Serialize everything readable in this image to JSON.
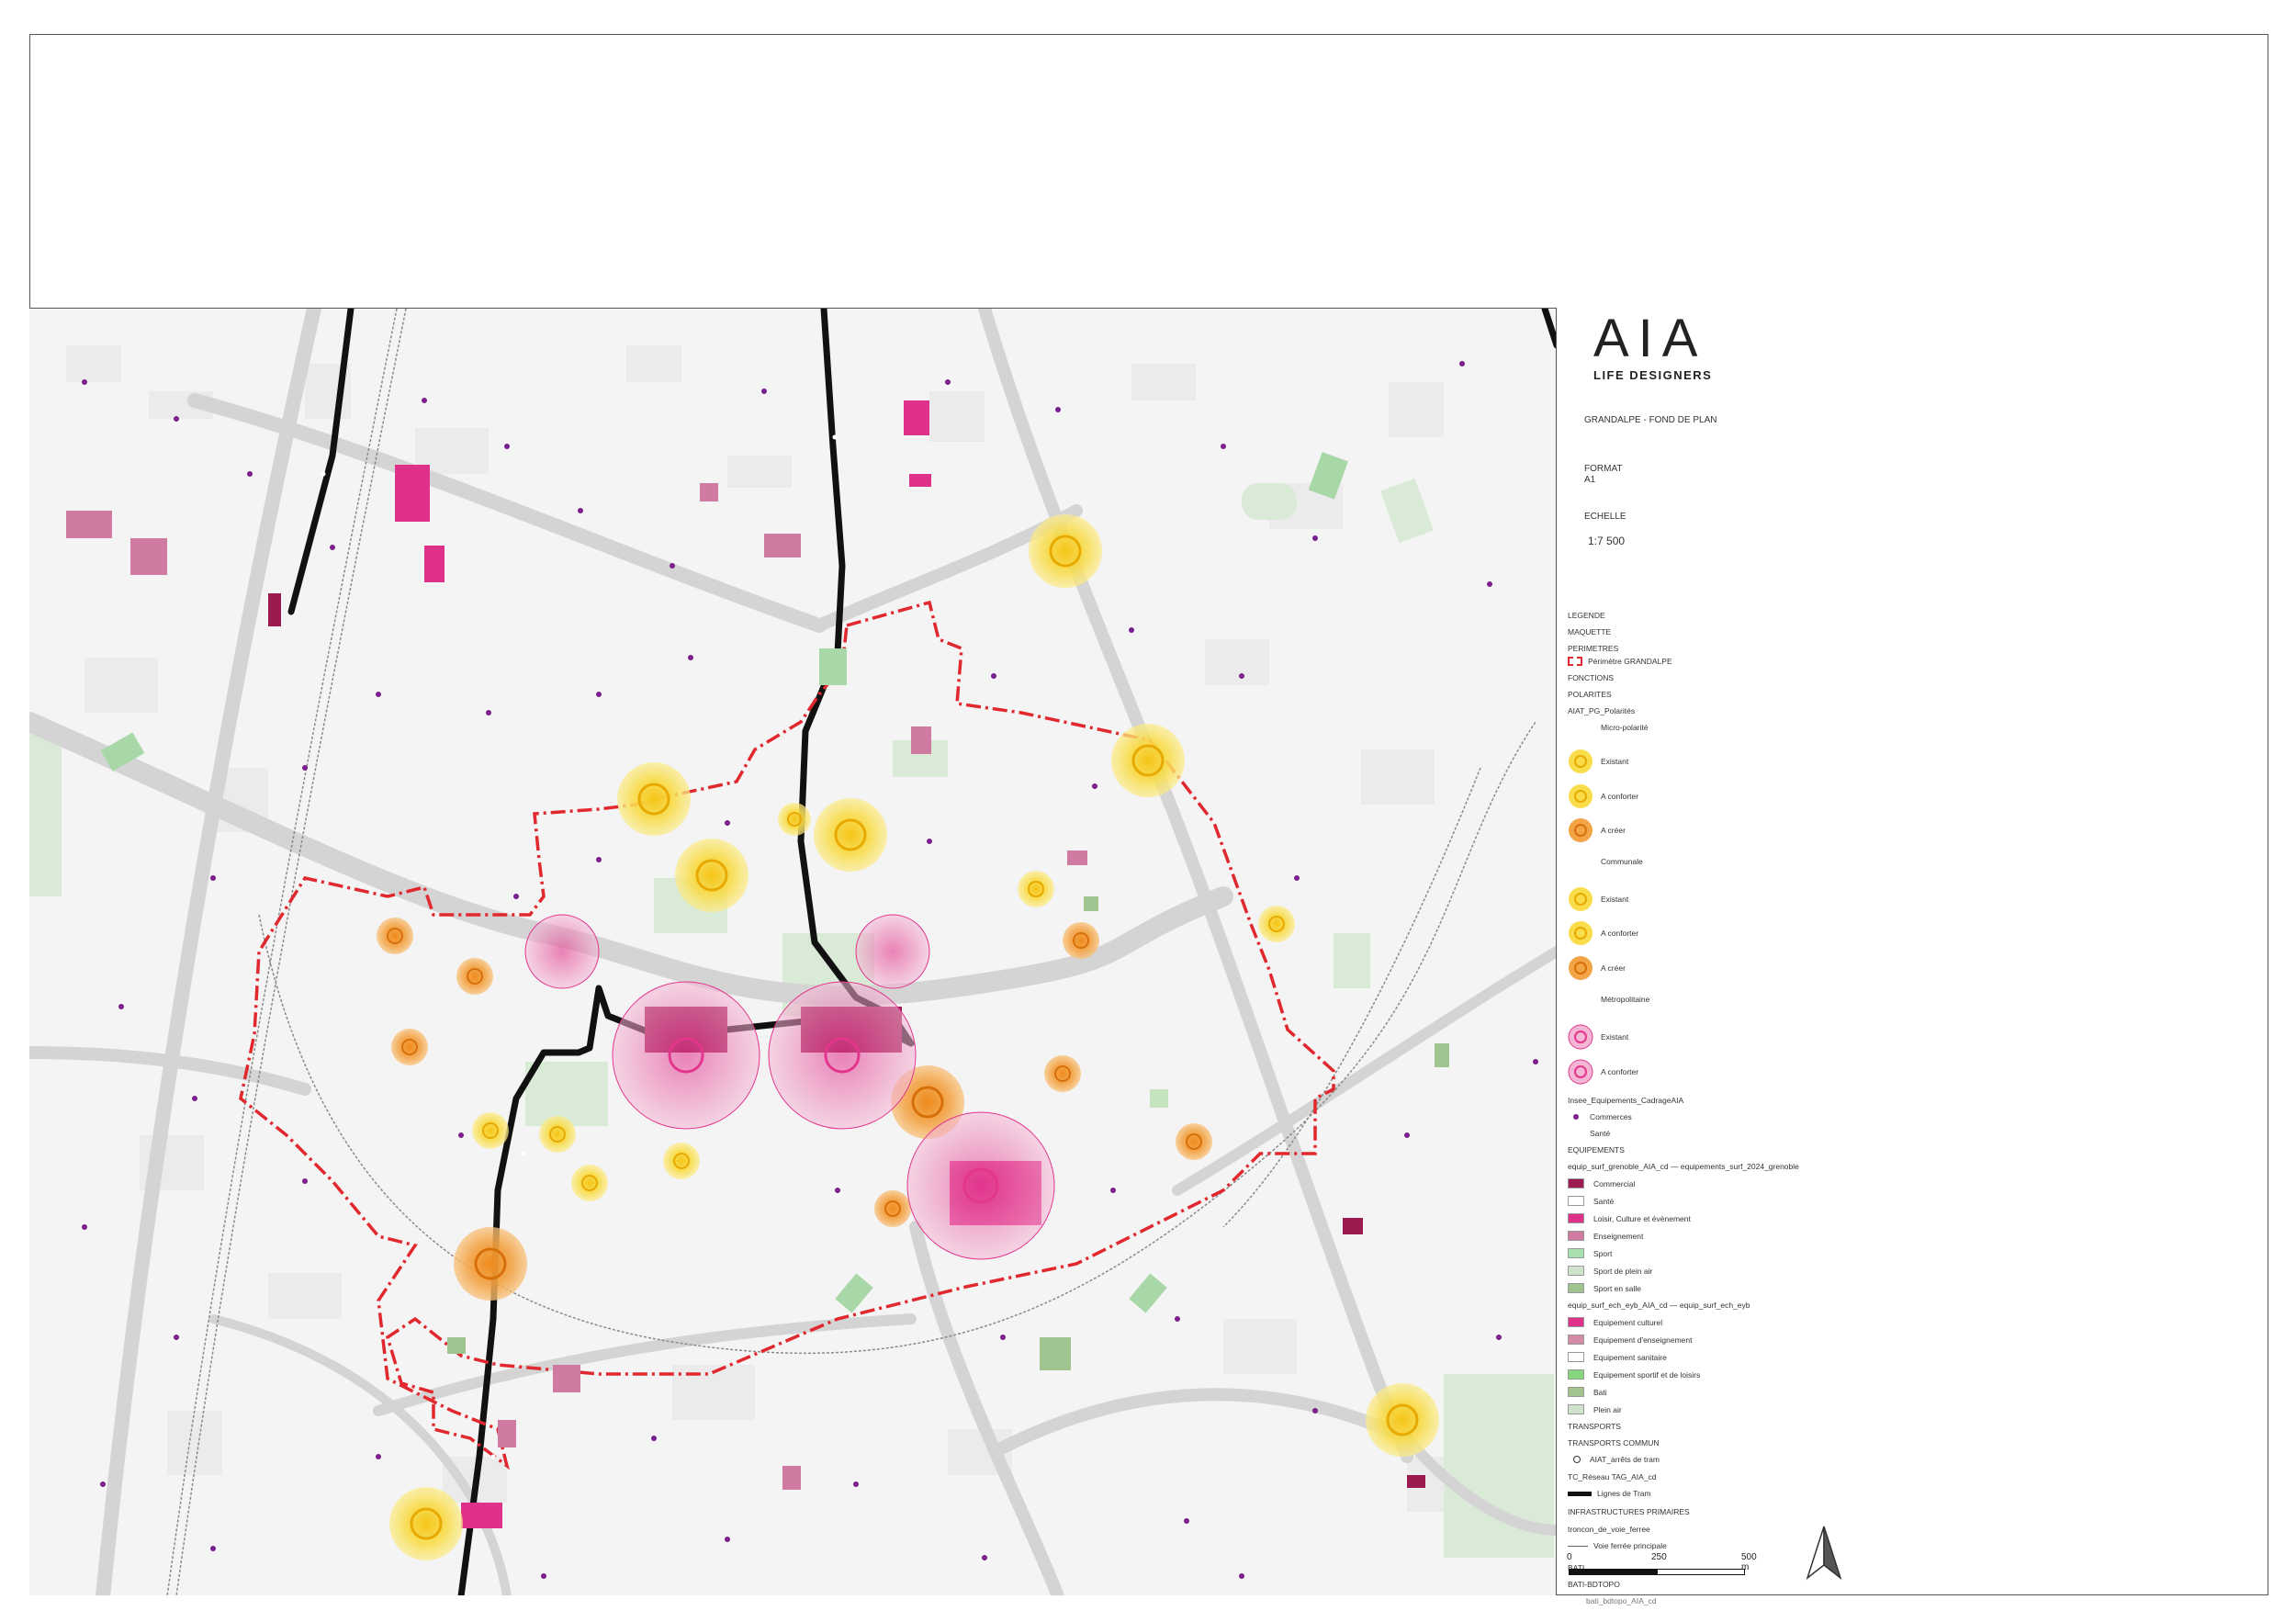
{
  "logo": {
    "word": "AIA",
    "sub": "LIFE DESIGNERS"
  },
  "meta": {
    "project": "GRANDALPE - FOND DE PLAN",
    "format_label": "FORMAT",
    "format_value": "A1",
    "scale_label": "ECHELLE",
    "scale_value": "1:7 500"
  },
  "legend": {
    "title": "LEGENDE",
    "maquette": "MAQUETTE",
    "perimetres": "PERIMETRES",
    "perimetre_item": "Périmètre GRANDALPE",
    "fonctions": "FONCTIONS",
    "polarites": "POLARITES",
    "polarites_layer": "AIAT_PG_Polarités",
    "micro": "Micro-polarité",
    "communale": "Communale",
    "metropolitaine": "Métropolitaine",
    "existant": "Existant",
    "a_conforter": "A conforter",
    "a_creer": "A créer",
    "insee_layer": "Insee_Equipements_CadrageAIA",
    "commerces": "Commerces",
    "sante": "Santé",
    "equipements": "EQUIPEMENTS",
    "equip_layer1": "equip_surf_grenoble_AIA_cd — equipements_surf_2024_grenoble",
    "eq1": [
      "Commercial",
      "Santé",
      "Loisir, Culture et évènement",
      "Enseignement",
      "Sport",
      "Sport de plein air",
      "Sport en salle"
    ],
    "equip_layer2": "equip_surf_ech_eyb_AIA_cd — equip_surf_ech_eyb",
    "eq2": [
      "Equipement culturel",
      "Equipement d'enseignement",
      "Equipement sanitaire",
      "Equipement sportif et de loisirs",
      "Bati",
      "Plein air"
    ],
    "transports": "TRANSPORTS",
    "transports_commun": "TRANSPORTS COMMUN",
    "arrets": "AIAT_arrêts de tram",
    "reseau_layer": "TC_Réseau TAG_AIA_cd",
    "lignes_tram": "Lignes de Tram",
    "infra": "INFRASTRUCTURES PRIMAIRES",
    "troncon": "troncon_de_voie_ferree",
    "voie_ferree": "Voie ferrée principale",
    "bati": "BATI",
    "bati_botopo": "BATI-BDTOPO",
    "bati_layer": "bati_bdtopo_AIA_cd"
  },
  "scalebar": {
    "zero": "0",
    "mid": "250",
    "end": "500 m"
  },
  "colors": {
    "perimeter": "#e0282e",
    "tram": "#111111",
    "road": "#d4d4d4",
    "rail": "#8a8a8a",
    "micro_existant": "#f7d21e",
    "micro_creer": "#f29a2a",
    "metro": "#e2368c",
    "commercial": "#9b1a50",
    "loisir": "#e0318a",
    "enseignement": "#cf7aa0",
    "sport": "#a8d8a8",
    "plein_air": "#cfe3cc",
    "sport_salle": "#9fc48f",
    "commerces_dot": "#7b1f8c"
  }
}
